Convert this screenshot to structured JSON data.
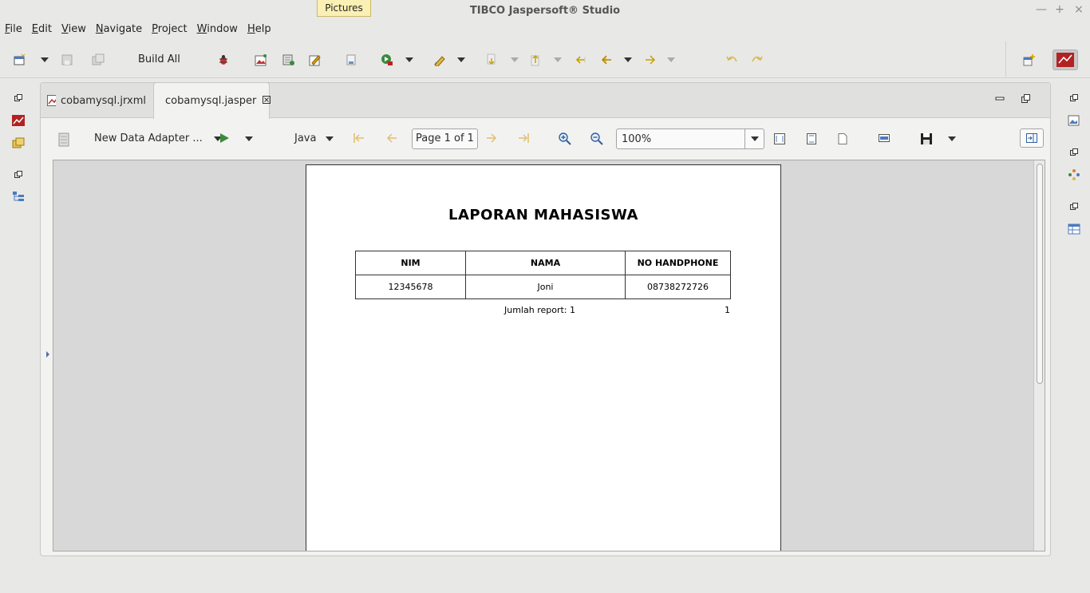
{
  "window": {
    "title": "TIBCO Jaspersoft® Studio",
    "tooltip": "Pictures",
    "controls": [
      "—",
      "+",
      "×"
    ]
  },
  "menu": [
    "File",
    "Edit",
    "View",
    "Navigate",
    "Project",
    "Window",
    "Help"
  ],
  "toolbar": {
    "build_all_label": "Build All",
    "icons": [
      "new-icon",
      "save-icon",
      "save-all-icon",
      "debug-icon",
      "image-icon",
      "data-icon",
      "edit-icon",
      "report-icon",
      "run-icon",
      "pen-icon",
      "down-icon",
      "up-icon",
      "back-icon",
      "prev-icon",
      "next-icon",
      "undo-icon",
      "redo-icon"
    ],
    "perspective_icon": "jaspersoft-perspective-icon"
  },
  "tabs": [
    {
      "label": "cobamysql.jrxml",
      "active": false
    },
    {
      "label": "cobamysql.jasper",
      "active": true
    }
  ],
  "preview_toolbar": {
    "adapter_label": "New Data Adapter ...",
    "language_label": "Java",
    "page_indicator": "Page 1 of 1",
    "zoom_value": "100%"
  },
  "report": {
    "title": "LAPORAN MAHASISWA",
    "columns": [
      "NIM",
      "NAMA",
      "NO HANDPHONE"
    ],
    "rows": [
      [
        "12345678",
        "Joni",
        "08738272726"
      ]
    ],
    "footer_label": "Jumlah report: 1",
    "page_number": "1"
  },
  "colors": {
    "accent": "#3c8a3c",
    "brand_red": "#b22222",
    "tooltip_bg": "#fbf0b4"
  }
}
